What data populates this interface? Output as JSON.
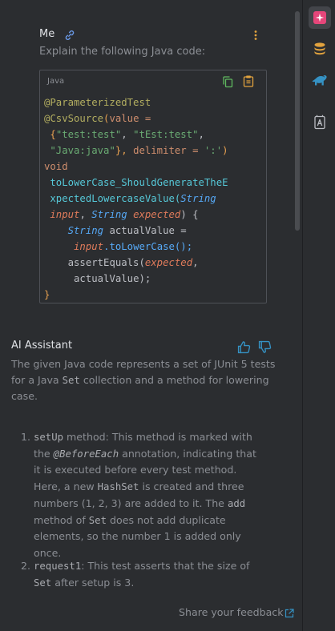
{
  "user": {
    "name": "Me",
    "prompt": "Explain the following Java code:"
  },
  "code_block": {
    "language": "Java",
    "tokens": {
      "t1": "@ParameterizedTest",
      "t2": "@CsvSource",
      "t3": "(",
      "t4": "value =",
      "t5": "{",
      "t6": "\"test:test\"",
      "t7": ", ",
      "t8": "\"tEst:test\"",
      "t9": ",",
      "t10": "\"Java:java\"",
      "t11": "}, ",
      "t12": "delimiter = ",
      "t13": "':'",
      "t14": ")",
      "t15": "void",
      "t16": "toLowerCase_ShouldGenerateTheE",
      "t17": "xpectedLowercaseValue(",
      "t18": "String",
      "t19": "input",
      "t20": ", ",
      "t21": "String",
      "t22": "expected",
      "t23": ") {",
      "t24": "String",
      "t25": " actualValue =",
      "t26": "input",
      "t27": ".toLowerCase();",
      "t28": "assertEquals(",
      "t29": "expected",
      "t30": ",",
      "t31": "actualValue);",
      "t32": "}"
    }
  },
  "assistant": {
    "name": "AI Assistant",
    "intro": {
      "a": "The given Java code represents a set of JUnit 5 tests for a Java ",
      "b": "Set",
      "c": " collection and a method for lowering case."
    },
    "items": [
      {
        "num": "1.",
        "p1": "setUp",
        "p2": " method: This method is marked with the ",
        "p3": "@BeforeEach",
        "p4": " annotation, indicating that it is executed before every test method. Here, a new ",
        "p5": "HashSet",
        "p6": " is created and three numbers (1, 2, 3) are added to it. The ",
        "p7": "add",
        "p8": " method of ",
        "p9": "Set",
        "p10": " does not add duplicate elements, so the number 1 is added only once."
      },
      {
        "num": "2.",
        "p1": "request1",
        "p2": ": This test asserts that the size of ",
        "p3": "Set",
        "p4": " after setup is 3."
      }
    ],
    "feedback": "Share your feedback"
  },
  "colors": {
    "background": "#2b2d30",
    "accent_pink": "#e5467a",
    "accent_blue": "#3592c4",
    "accent_yellow": "#e2a33e"
  },
  "icons": [
    "link-icon",
    "more-icon",
    "copy-icon",
    "paste-icon",
    "thumbs-up-icon",
    "thumbs-down-icon",
    "external-link-icon",
    "ai-assistant-icon",
    "database-icon",
    "gradle-elephant-icon",
    "documentation-icon"
  ]
}
